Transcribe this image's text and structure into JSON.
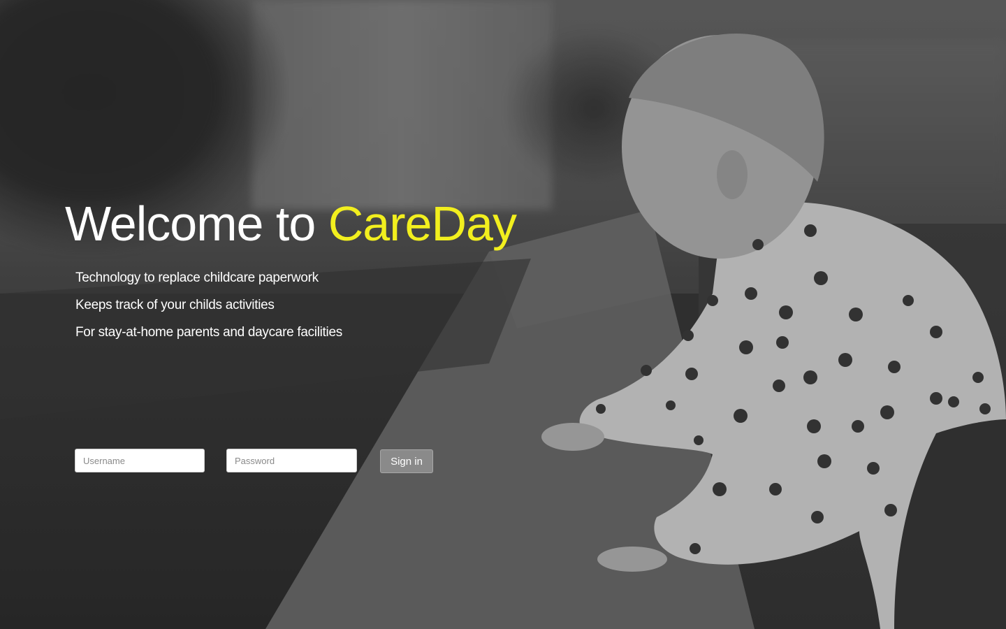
{
  "hero": {
    "title_prefix": "Welcome to ",
    "brand_name": "CareDay"
  },
  "taglines": [
    "Technology to replace childcare paperwork",
    "Keeps track of your childs activities",
    "For stay-at-home parents and daycare facilities"
  ],
  "login": {
    "username_placeholder": "Username",
    "password_placeholder": "Password",
    "signin_label": "Sign in"
  },
  "colors": {
    "brand_accent": "#f2ef1e",
    "text": "#ffffff",
    "button_bg": "#8a8a8a"
  }
}
